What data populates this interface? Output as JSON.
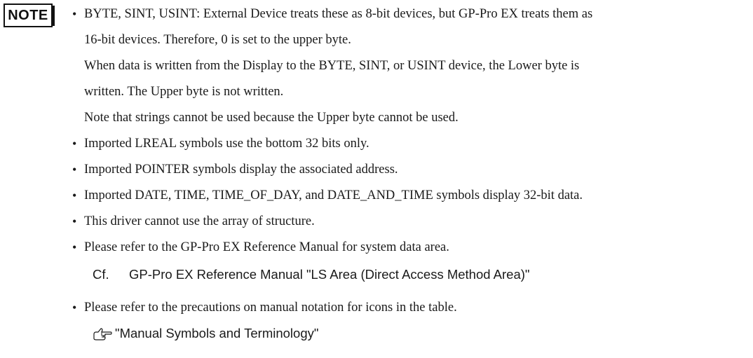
{
  "note": {
    "badge_label": "NOTE"
  },
  "bullets": [
    {
      "lines": [
        "BYTE, SINT, USINT: External Device treats these as 8-bit devices, but GP-Pro EX treats them as",
        "16-bit devices. Therefore, 0 is set to the upper byte.",
        "When data is written from the Display to the BYTE, SINT, or USINT device, the Lower byte is",
        "written. The Upper byte is not written.",
        "Note that strings cannot be used because the Upper byte cannot be used."
      ]
    },
    {
      "lines": [
        "Imported LREAL symbols use the bottom 32 bits only."
      ]
    },
    {
      "lines": [
        "Imported POINTER symbols display the associated address."
      ]
    },
    {
      "lines": [
        "Imported DATE, TIME, TIME_OF_DAY, and DATE_AND_TIME symbols display 32-bit data."
      ]
    },
    {
      "lines": [
        "This driver cannot use the array of structure."
      ]
    },
    {
      "lines": [
        "Please refer to the GP-Pro EX Reference Manual for system data area."
      ]
    },
    {
      "lines": [
        "Please refer to the precautions on manual notation for icons in the table."
      ]
    }
  ],
  "bullet_char": "•",
  "reference": {
    "prefix": "Cf.",
    "text": "GP-Pro EX Reference Manual \"LS Area (Direct Access Method Area)\""
  },
  "link": {
    "icon": "pointing-hand-icon",
    "text": "\"Manual Symbols and Terminology\""
  }
}
